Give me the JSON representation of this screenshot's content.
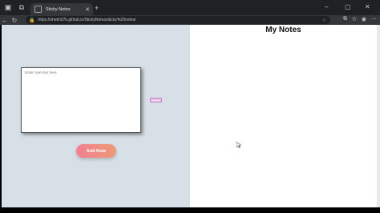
{
  "browser": {
    "tab_title": "Sticky Notes",
    "tab_close": "✕",
    "new_tab": "+",
    "url": "https://shekh07k.github.io/StickyNotes/sticky%20notes/",
    "window_controls": [
      "–",
      "▢",
      "✕"
    ]
  },
  "editor": {
    "placeholder": "Enter note text here"
  },
  "actions": {
    "add_label": "Add Note"
  },
  "notes_panel": {
    "title": "My Notes"
  },
  "colors": {
    "left_bg": "#d6e0e6",
    "button_from": "#f08090",
    "button_to": "#ee9a78",
    "ghost_note": "#e6b8e8"
  }
}
